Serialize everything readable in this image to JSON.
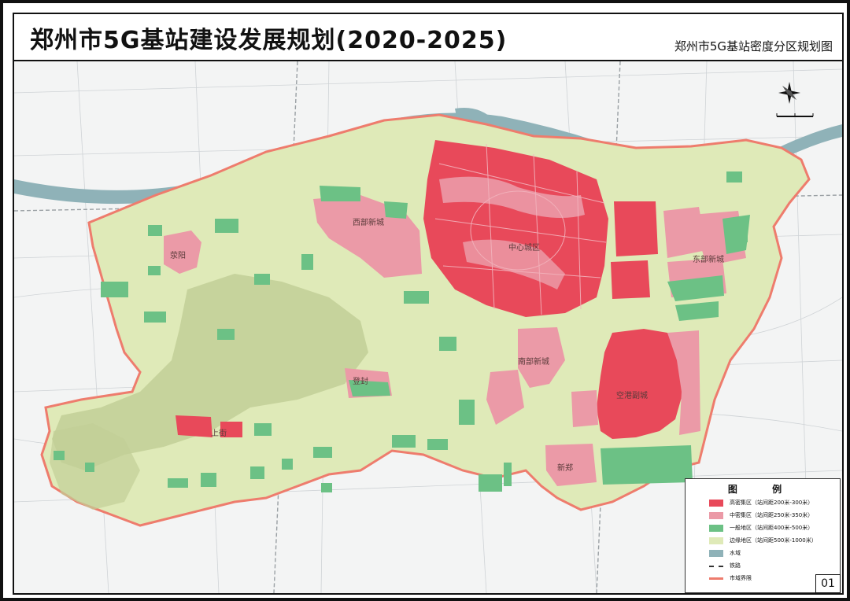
{
  "header": {
    "title": "郑州市5G基站建设发展规划(2020-2025)",
    "subtitle": "郑州市5G基站密度分区规划图"
  },
  "map": {
    "labels": {
      "center": "中心城区",
      "xiwu": "西部新城",
      "xingyang": "荥阳",
      "airport": "空港副城",
      "east": "东部新城",
      "south": "南部新城",
      "xinzheng": "新郑",
      "west1": "上街",
      "west2": "登封"
    },
    "colors": {
      "high": "#e8495a",
      "mid": "#eb9aa7",
      "general": "#6cc185",
      "edge": "#dfeab8",
      "water": "#8fb2b8",
      "mountain": "#c2cf97",
      "boundary": "#ee7c6d",
      "background": "#f3f4f4"
    }
  },
  "legend": {
    "title": "图 例",
    "items": [
      {
        "label": "高密集区（站间距200米-300米）",
        "color": "#e8495a",
        "kind": "fill"
      },
      {
        "label": "中密集区（站间距250米-350米）",
        "color": "#eb9aa7",
        "kind": "fill"
      },
      {
        "label": "一般地区（站间距400米-500米）",
        "color": "#6cc185",
        "kind": "fill"
      },
      {
        "label": "边缘地区（站间距500米-1000米）",
        "color": "#dfeab8",
        "kind": "fill"
      },
      {
        "label": "水域",
        "color": "#8fb2b8",
        "kind": "fill"
      },
      {
        "label": "铁路",
        "color": "#333333",
        "kind": "rail"
      },
      {
        "label": "市域界限",
        "color": "#ee7c6d",
        "kind": "boundary"
      }
    ]
  },
  "page_number": "01"
}
